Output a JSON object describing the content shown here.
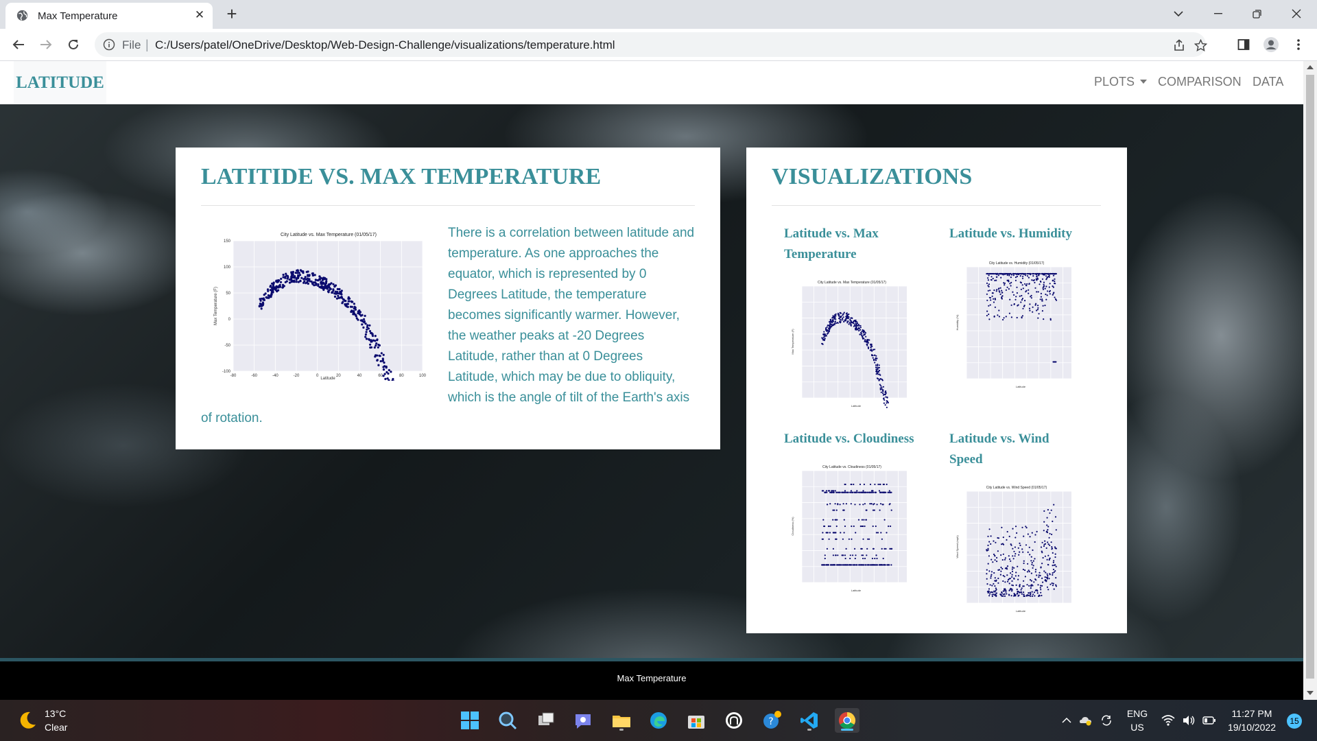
{
  "browser": {
    "tab_title": "Max Temperature",
    "url_scheme_label": "File",
    "url": "C:/Users/patel/OneDrive/Desktop/Web-Design-Challenge/visualizations/temperature.html"
  },
  "navbar": {
    "brand": "LATITUDE",
    "plots_label": "PLOTS",
    "comparison_label": "COMPARISON",
    "data_label": "DATA"
  },
  "main_card": {
    "title": "LATITIDE VS. MAX TEMPERATURE",
    "description": "There is a correlation between latitude and temperature. As one approaches the equator, which is represented by 0 Degrees Latitude, the temperature becomes significantly warmer. However, the weather peaks at -20 Degrees Latitude, rather than at 0 Degrees Latitude, which may be due to obliquity, which is the angle of tilt of the Earth's axis of rotation.",
    "plot": {
      "title": "City Latitude vs. Max Temperature (01/05/17)",
      "xlabel": "Latitude",
      "ylabel": "Max Temperature (F)",
      "xticks": [
        "-80",
        "-60",
        "-40",
        "-20",
        "0",
        "20",
        "40",
        "60",
        "80",
        "100"
      ],
      "yticks": [
        "150",
        "100",
        "50",
        "0",
        "-50",
        "-100"
      ]
    }
  },
  "viz_card": {
    "title": "VISUALIZATIONS",
    "items": [
      {
        "title": "Latitude vs. Max Temperature",
        "plot_title": "City Latitude vs. Max Temperature (01/05/17)",
        "ylabel": "Max Temperature (F)"
      },
      {
        "title": "Latitude vs. Humidity",
        "plot_title": "City Latitude vs. Humidity (01/05/17)",
        "ylabel": "Humidity (%)"
      },
      {
        "title": "Latitude vs. Cloudiness",
        "plot_title": "City Latitude vs. Cloudiness (01/05/17)",
        "ylabel": "Cloudiness (%)"
      },
      {
        "title": "Latitude vs. Wind Speed",
        "plot_title": "City Latitude vs. Wind Speed (01/05/17)",
        "ylabel": "Wind Speed (mph)"
      }
    ],
    "xlabel": "Latitude"
  },
  "footer": {
    "text": "Max Temperature"
  },
  "taskbar": {
    "temperature": "13°C",
    "condition": "Clear",
    "language": "ENG",
    "region": "US",
    "time": "11:27 PM",
    "date": "19/10/2022",
    "notification_count": "15"
  },
  "colors": {
    "accent": "#3a8f99",
    "marker": "#0b0b6e",
    "plot_bg": "#eaeaf2"
  }
}
